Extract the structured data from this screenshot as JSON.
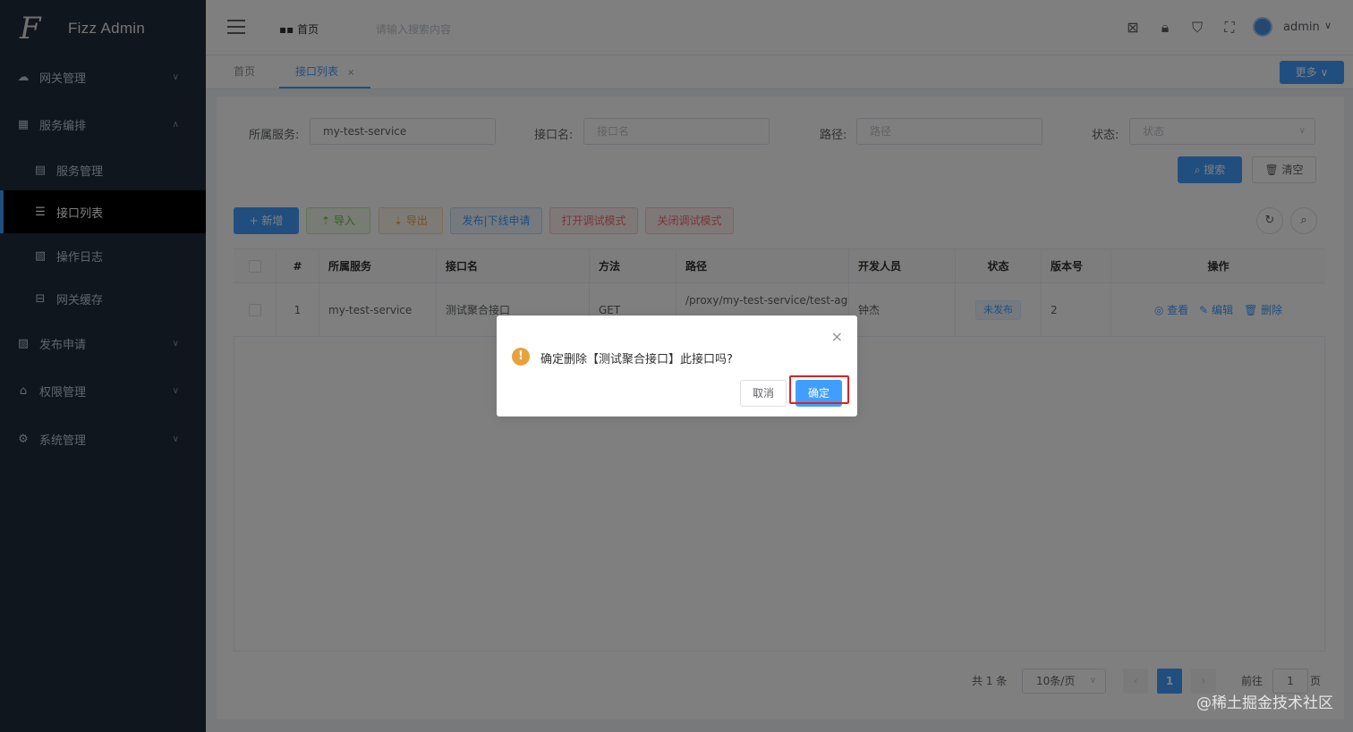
{
  "app": {
    "title": "Fizz Admin"
  },
  "sidebar": {
    "items": [
      {
        "label": "网关管理",
        "icon": "cloud-icon",
        "expanded": false
      },
      {
        "label": "服务编排",
        "icon": "grid-icon",
        "expanded": true
      },
      {
        "label": "服务管理",
        "icon": "server-icon",
        "sub": true
      },
      {
        "label": "接口列表",
        "icon": "list-icon",
        "sub": true,
        "active": true
      },
      {
        "label": "操作日志",
        "icon": "log-icon",
        "sub": true
      },
      {
        "label": "网关缓存",
        "icon": "cache-icon",
        "sub": true
      },
      {
        "label": "发布申请",
        "icon": "publish-icon",
        "expanded": false
      },
      {
        "label": "权限管理",
        "icon": "lock-icon",
        "expanded": false
      },
      {
        "label": "系统管理",
        "icon": "gear-icon",
        "expanded": false
      }
    ]
  },
  "header": {
    "home": "首页",
    "search_placeholder": "请输入搜索内容",
    "user": "admin"
  },
  "tabs": {
    "items": [
      {
        "label": "首页",
        "active": false
      },
      {
        "label": "接口列表",
        "active": true,
        "closable": true
      }
    ],
    "close_glyph": "×",
    "more": "更多"
  },
  "filters": {
    "service_label": "所属服务:",
    "service_value": "my-test-service",
    "api_label": "接口名:",
    "api_placeholder": "接口名",
    "path_label": "路径:",
    "path_placeholder": "路径",
    "status_label": "状态:",
    "status_placeholder": "状态",
    "search": "搜索",
    "clear": "清空"
  },
  "toolbar": {
    "add": "新增",
    "import": "导入",
    "export": "导出",
    "publish": "发布|下线申请",
    "open_debug": "打开调试模式",
    "close_debug": "关闭调试模式"
  },
  "table": {
    "columns": [
      "#",
      "所属服务",
      "接口名",
      "方法",
      "路径",
      "开发人员",
      "状态",
      "版本号",
      "操作"
    ],
    "rows": [
      {
        "index": "1",
        "service": "my-test-service",
        "name": "测试聚合接口",
        "method": "GET",
        "path": "/proxy/my-test-service/test-aggre",
        "developer": "钟杰",
        "status": "未发布",
        "version": "2",
        "actions": {
          "view": "查看",
          "edit": "编辑",
          "delete": "删除"
        }
      }
    ]
  },
  "pagination": {
    "total": "共 1 条",
    "page_size": "10条/页",
    "current": "1",
    "goto_prefix": "前往",
    "goto_value": "1",
    "goto_suffix": "页"
  },
  "dialog": {
    "message": "确定删除【测试聚合接口】此接口吗?",
    "cancel": "取消",
    "confirm": "确定",
    "warn_glyph": "!",
    "close_glyph": "×"
  },
  "watermark": "@稀土掘金技术社区",
  "colors": {
    "primary": "#409eff",
    "sidebar": "#1f2d3d",
    "warning": "#e6a23c",
    "highlight": "#e02020"
  }
}
